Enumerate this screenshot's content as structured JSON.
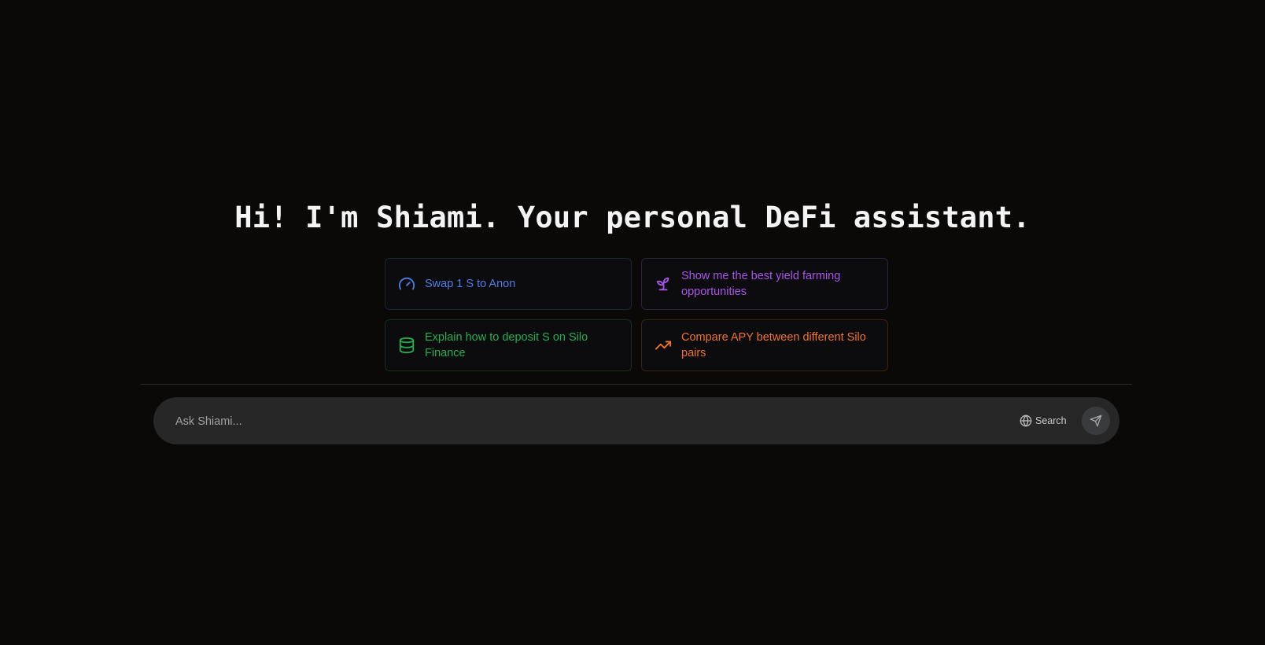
{
  "header": {
    "title": "Hi! I'm Shiami. Your personal DeFi assistant."
  },
  "suggestions": [
    {
      "label": "Swap 1 S to Anon",
      "icon": "speedometer-icon",
      "color": "#4d7fe6"
    },
    {
      "label": "Show me the best yield farming opportunities",
      "icon": "sprout-icon",
      "color": "#a855e8"
    },
    {
      "label": "Explain how to deposit S on Silo Finance",
      "icon": "database-icon",
      "color": "#22b052"
    },
    {
      "label": "Compare APY between different Silo pairs",
      "icon": "trending-up-icon",
      "color": "#f27325"
    }
  ],
  "chat": {
    "placeholder": "Ask Shiami...",
    "value": "",
    "search_label": "Search",
    "search_icon": "globe-icon",
    "send_icon": "send-icon"
  }
}
